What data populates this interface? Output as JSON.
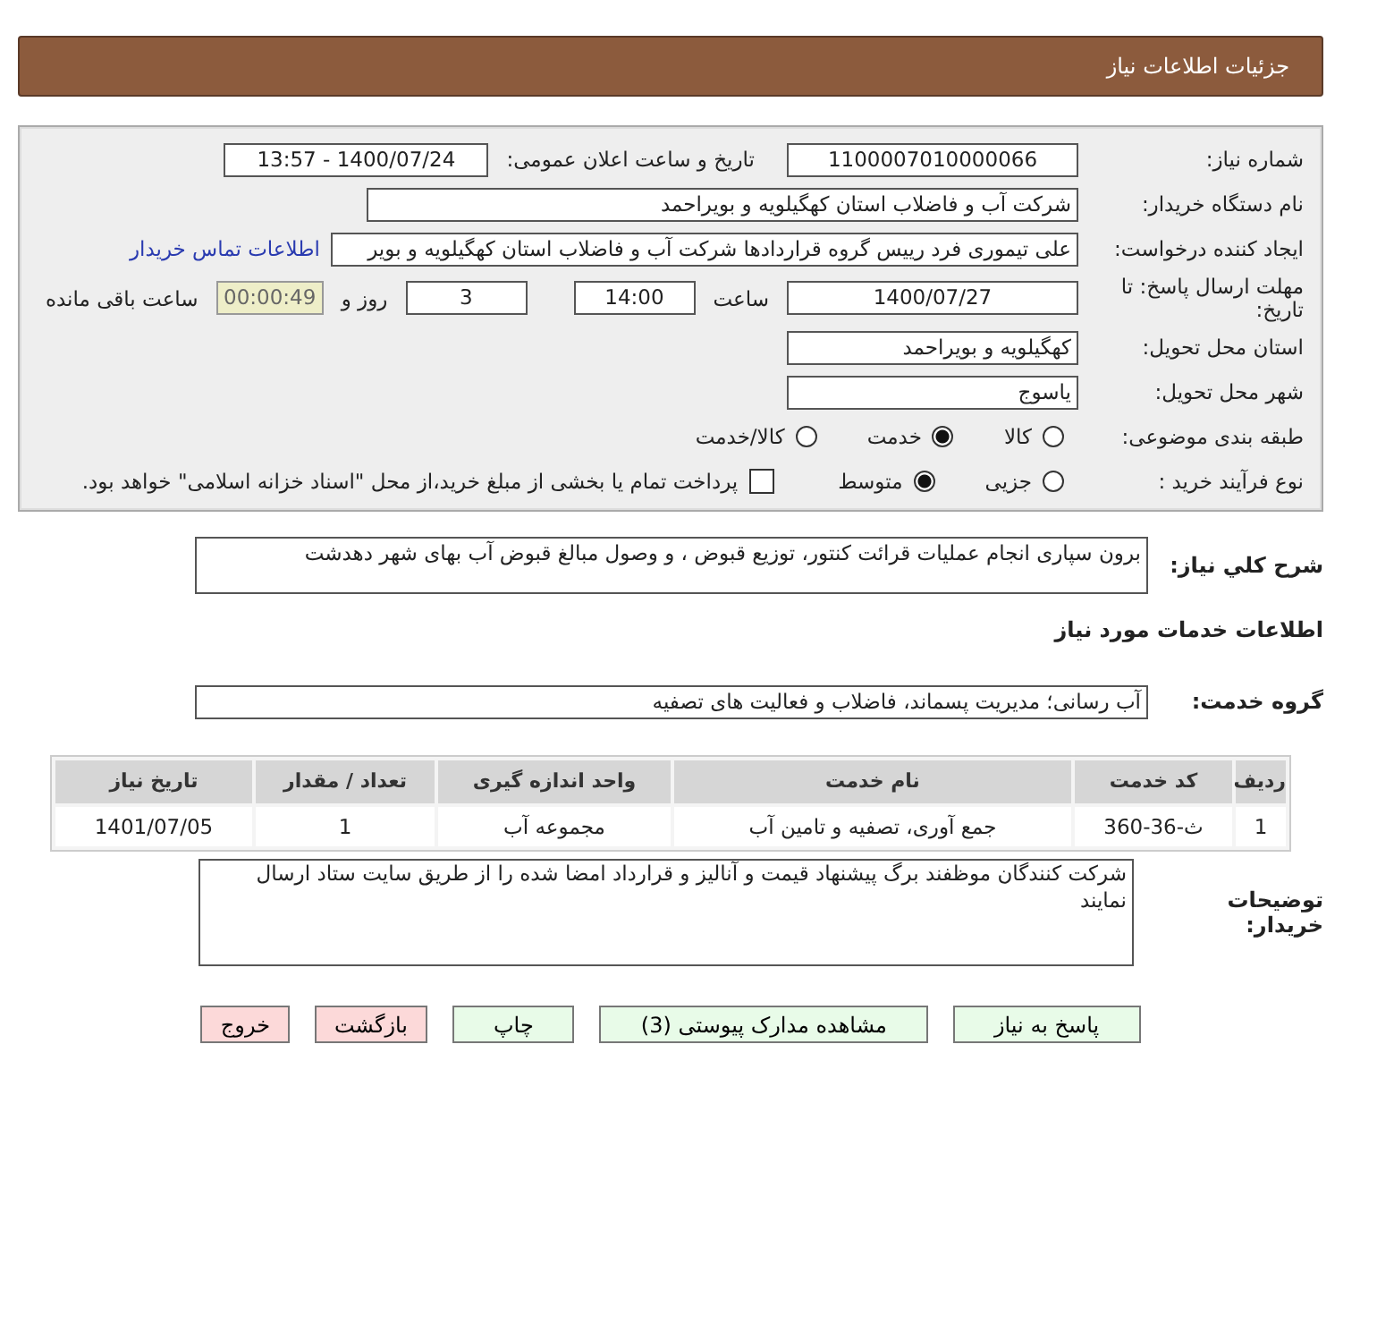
{
  "header": {
    "title": "جزئیات اطلاعات نیاز"
  },
  "need_number": {
    "label": "شماره نیاز:",
    "value": "1100007010000066"
  },
  "announce": {
    "label": "تاریخ و ساعت اعلان عمومی:",
    "value": "1400/07/24 - 13:57"
  },
  "buyer_org": {
    "label": "نام دستگاه خریدار:",
    "value": "شرکت آب و فاضلاب استان کهگیلویه و بویراحمد"
  },
  "requester": {
    "label": "ایجاد کننده درخواست:",
    "value": "علی تیموری فرد رییس گروه قراردادها شرکت آب و فاضلاب استان کهگیلویه و بویر",
    "link": "اطلاعات تماس خریدار"
  },
  "deadline": {
    "label": "مهلت ارسال پاسخ: تا تاریخ:",
    "date": "1400/07/27",
    "time_label": "ساعت",
    "time": "14:00",
    "days": "3",
    "days_label": "روز و",
    "remaining": "00:00:49",
    "remaining_label": "ساعت باقی مانده"
  },
  "delivery_province": {
    "label": "استان محل تحویل:",
    "value": "کهگیلویه و بویراحمد"
  },
  "delivery_city": {
    "label": "شهر محل تحویل:",
    "value": "یاسوج"
  },
  "category": {
    "label": "طبقه بندی موضوعی:",
    "options": [
      {
        "label": "کالا",
        "selected": false
      },
      {
        "label": "خدمت",
        "selected": true
      },
      {
        "label": "کالا/خدمت",
        "selected": false
      }
    ]
  },
  "process": {
    "label": "نوع فرآیند خرید :",
    "options": [
      {
        "label": "جزیی",
        "selected": false
      },
      {
        "label": "متوسط",
        "selected": true
      }
    ],
    "payment": {
      "checked": false,
      "label": "پرداخت تمام یا بخشی از مبلغ خرید،از محل \"اسناد خزانه اسلامی\" خواهد بود."
    }
  },
  "description": {
    "label": "شرح کلي نياز:",
    "value": "برون سپاری انجام عملیات قرائت کنتور، توزیع قبوض ، و وصول مبالغ قبوض آب بهای شهر دهدشت"
  },
  "services_heading": "اطلاعات خدمات مورد نیاز",
  "service_group": {
    "label": "گروه خدمت:",
    "value": "آب رسانی؛ مدیریت پسماند، فاضلاب و فعالیت های تصفیه"
  },
  "table": {
    "columns": [
      "ردیف",
      "کد خدمت",
      "نام خدمت",
      "واحد اندازه گیری",
      "تعداد / مقدار",
      "تاریخ نیاز"
    ],
    "rows": [
      [
        "1",
        "ث-36-360",
        "جمع آوری، تصفیه و تامین آب",
        "مجموعه آب",
        "1",
        "1401/07/05"
      ]
    ]
  },
  "buyer_notes": {
    "label": "توضیحات خریدار:",
    "value": "شرکت کنندگان موظفند برگ پیشنهاد قیمت و آنالیز و قرارداد امضا شده را از طریق سایت ستاد ارسال نمایند"
  },
  "buttons": [
    {
      "label": "پاسخ به نیاز",
      "kind": "normal"
    },
    {
      "label": "مشاهده مدارک پیوستی (3)",
      "kind": "normal"
    },
    {
      "label": "چاپ",
      "kind": "normal"
    },
    {
      "label": "بازگشت",
      "kind": "danger"
    },
    {
      "label": "خروج",
      "kind": "danger"
    }
  ]
}
